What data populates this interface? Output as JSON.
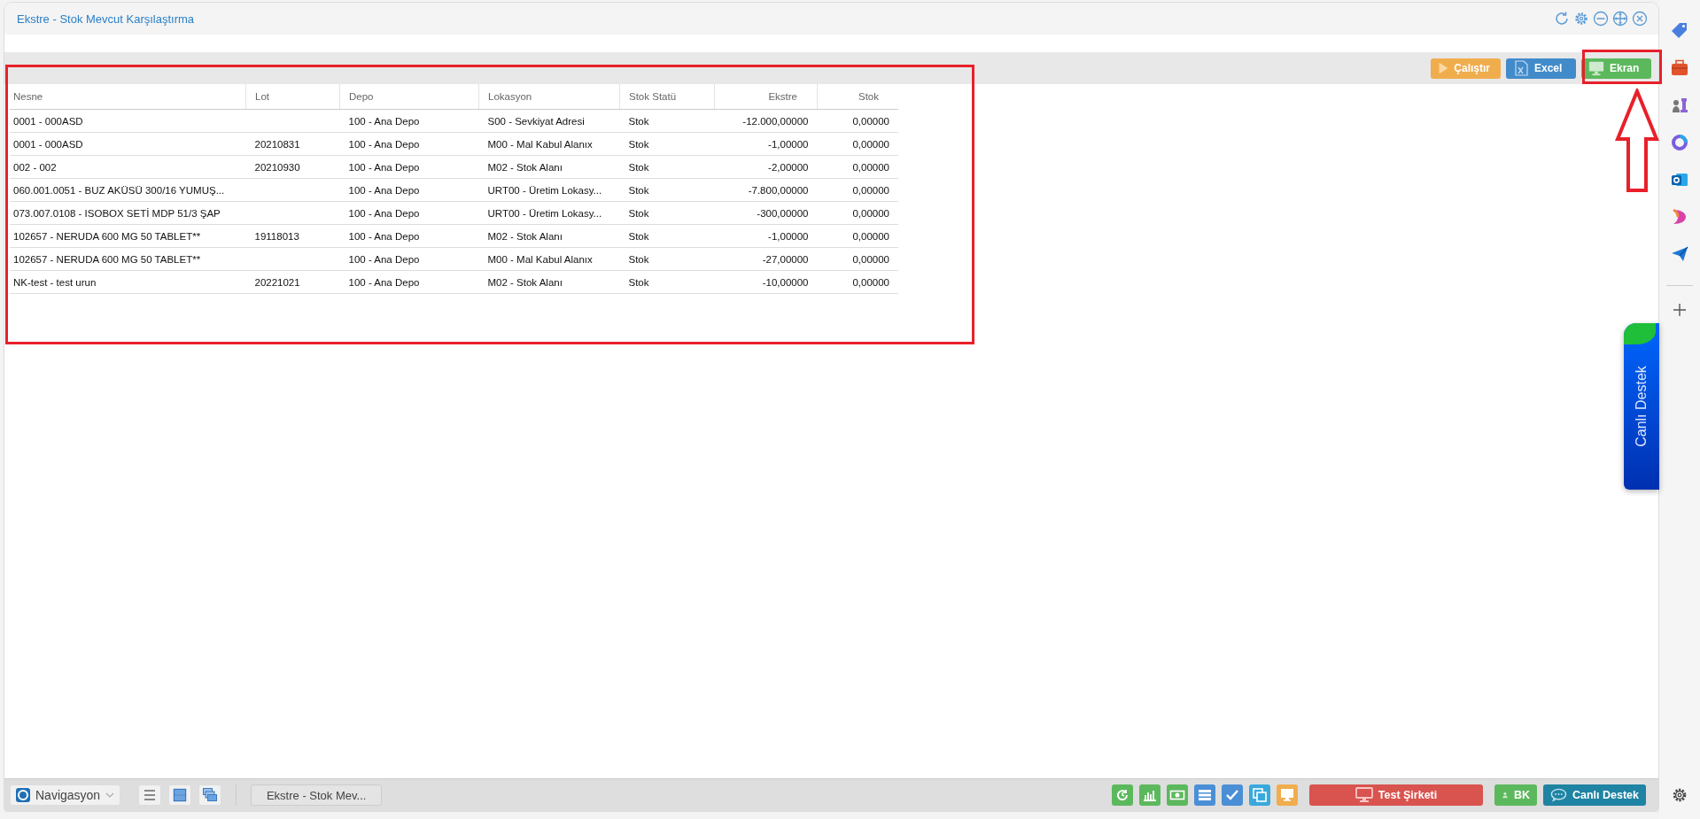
{
  "window": {
    "title": "Ekstre - Stok Mevcut Karşılaştırma"
  },
  "toolbar": {
    "buttons": [
      {
        "label": "Çalıştır",
        "kind": "run"
      },
      {
        "label": "Excel",
        "kind": "excel"
      },
      {
        "label": "Ekran",
        "kind": "screen"
      }
    ]
  },
  "table": {
    "columns": [
      {
        "label": "Nesne",
        "kind": "text"
      },
      {
        "label": "Lot",
        "kind": "text"
      },
      {
        "label": "Depo",
        "kind": "text"
      },
      {
        "label": "Lokasyon",
        "kind": "text"
      },
      {
        "label": "Stok Statü",
        "kind": "text"
      },
      {
        "label": "Ekstre",
        "kind": "number"
      },
      {
        "label": "Stok",
        "kind": "number"
      }
    ],
    "rows": [
      [
        "0001 - 000ASD",
        "",
        "100 - Ana Depo",
        "S00 - Sevkiyat Adresi",
        "Stok",
        "-12.000,00000",
        "0,00000"
      ],
      [
        "0001 - 000ASD",
        "20210831",
        "100 - Ana Depo",
        "M00 - Mal Kabul Alanıx",
        "Stok",
        "-1,00000",
        "0,00000"
      ],
      [
        "002 - 002",
        "20210930",
        "100 - Ana Depo",
        "M02 - Stok Alanı",
        "Stok",
        "-2,00000",
        "0,00000"
      ],
      [
        "060.001.0051 - BUZ AKÜSÜ 300/16 YUMUŞ...",
        "",
        "100 - Ana Depo",
        "URT00 - Üretim Lokasy...",
        "Stok",
        "-7.800,00000",
        "0,00000"
      ],
      [
        "073.007.0108 - ISOBOX SETİ MDP 51/3 ŞAP",
        "",
        "100 - Ana Depo",
        "URT00 - Üretim Lokasy...",
        "Stok",
        "-300,00000",
        "0,00000"
      ],
      [
        "102657 - NERUDA 600 MG 50 TABLET**",
        "19118013",
        "100 - Ana Depo",
        "M02 - Stok Alanı",
        "Stok",
        "-1,00000",
        "0,00000"
      ],
      [
        "102657 - NERUDA 600 MG 50 TABLET**",
        "",
        "100 - Ana Depo",
        "M00 - Mal Kabul Alanıx",
        "Stok",
        "-27,00000",
        "0,00000"
      ],
      [
        "NK-test - test urun",
        "20221021",
        "100 - Ana Depo",
        "M02 - Stok Alanı",
        "Stok",
        "-10,00000",
        "0,00000"
      ]
    ]
  },
  "taskbar": {
    "navigation": "Navigasyon",
    "window_tabs": [
      "Ekstre - Stok Mev..."
    ],
    "company": "Test Şirketi",
    "user": "BK",
    "support": "Canlı Destek"
  },
  "support_tab": {
    "label": "Canlı Destek"
  }
}
